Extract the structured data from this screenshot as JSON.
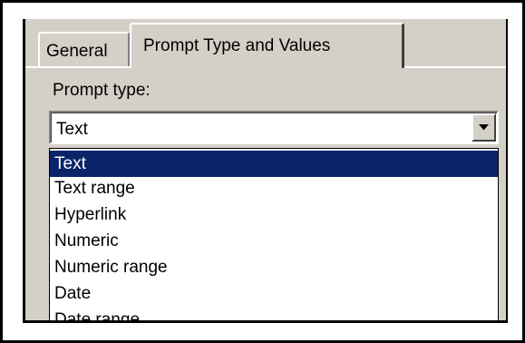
{
  "tabs": {
    "general": "General",
    "prompt_type_and_values": "Prompt Type and Values"
  },
  "prompt_type": {
    "label": "Prompt type:",
    "selected": "Text",
    "options": [
      {
        "label": "Text",
        "selected": true
      },
      {
        "label": "Text range"
      },
      {
        "label": "Hyperlink"
      },
      {
        "label": "Numeric"
      },
      {
        "label": "Numeric range"
      },
      {
        "label": "Date"
      },
      {
        "label": "Date range"
      }
    ]
  },
  "colors": {
    "dialog_bg": "#d4d0c8",
    "selection_bg": "#0a246a",
    "selection_text": "#ffffff"
  },
  "icons": {
    "dropdown_arrow": "chevron-down-icon"
  }
}
